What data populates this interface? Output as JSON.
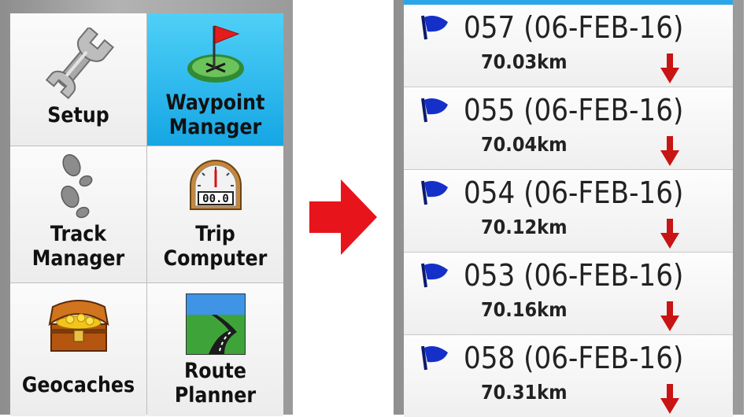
{
  "menu": {
    "tiles": [
      {
        "label": "Setup",
        "icon": "wrench-icon",
        "selected": false
      },
      {
        "label": "Waypoint\nManager",
        "icon": "waypoint-flag-icon",
        "selected": true
      },
      {
        "label": "Track\nManager",
        "icon": "footprints-icon",
        "selected": false
      },
      {
        "label": "Trip\nComputer",
        "icon": "speedometer-icon",
        "selected": false
      },
      {
        "label": "Geocaches",
        "icon": "treasure-chest-icon",
        "selected": false
      },
      {
        "label": "Route\nPlanner",
        "icon": "road-icon",
        "selected": false
      }
    ],
    "trip_odometer": "00.0"
  },
  "transition_arrow": "right-arrow-icon",
  "waypoints": [
    {
      "name": "057 (06-FEB-16)",
      "distance": "70.03km"
    },
    {
      "name": "055 (06-FEB-16)",
      "distance": "70.04km"
    },
    {
      "name": "054 (06-FEB-16)",
      "distance": "70.12km"
    },
    {
      "name": "053 (06-FEB-16)",
      "distance": "70.16km"
    },
    {
      "name": "058 (06-FEB-16)",
      "distance": "70.31km"
    }
  ],
  "colors": {
    "selected_tile": "#15a6e4",
    "arrow": "#e8141b",
    "flag": "#1430c8",
    "bearing_arrow": "#c81414"
  }
}
